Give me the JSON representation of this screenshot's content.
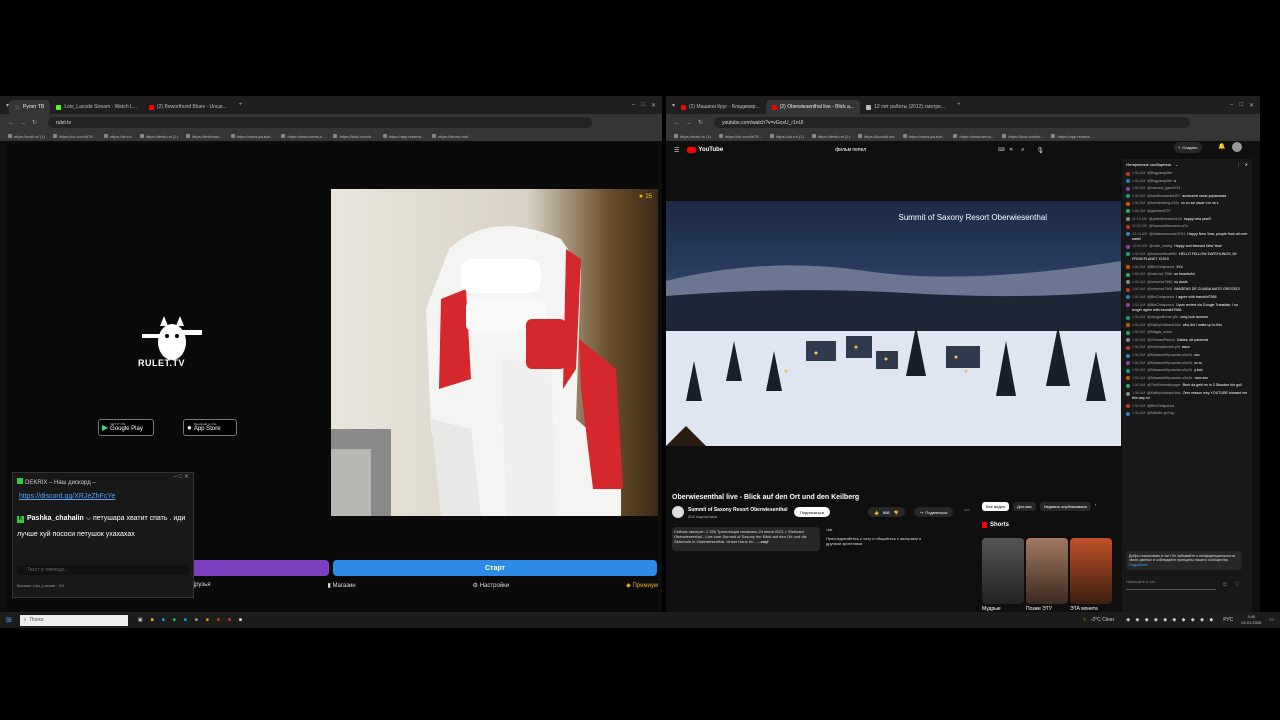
{
  "left_browser": {
    "tabs": [
      "Рулет ТВ",
      "Lois_Lacode Stream - Watch L...",
      "(2) Beworthund Blues - Uncar..."
    ],
    "url": "rulet.tv",
    "bookmarks": [
      "https://mail.ru/ (1)",
      "https://vk.com/id78...",
      "https://ok.ru/",
      "https://tenki.ru/ (1)",
      "https://textbook...",
      "https://www.youtub...",
      "https://www.forms.s...",
      "https://kick.com/lo...",
      "https://app.restrea...",
      "https://dtrmo.md/..."
    ],
    "rulet": {
      "brand": "RULET.TV",
      "google_play": "Google Play",
      "google_play_pre": "GET IT ON",
      "app_store": "App Store",
      "app_store_pre": "Download on the",
      "start_button": "Старт",
      "viewers": "25",
      "bottom_nav": [
        "Друзья",
        "Магазин",
        "Настройки",
        "Премиум"
      ]
    },
    "chat_overlay": {
      "line1": "DEKRIX – Наш дискорд –",
      "link": "https://discord.gg/XRJeZhFcYe",
      "user": "Pashka_chahalin",
      "message": "петушара хватит спать . иди лучше хуй пососи петушок ухахахах",
      "input_placeholder": "Текст в темпедо...",
      "footer_user": "Весная: Lois_Lacode",
      "footer_count": "0/1"
    }
  },
  "right_browser": {
    "tabs": [
      "(2) Машина Круг - Владимир...",
      "(2) Oberwiesenthal live - Blick a...",
      "12 лет работы (2012) смотре..."
    ],
    "url": "youtube.com/watch?v=vGosU_r1nUI",
    "bookmarks": [
      "https://mail.ru/ (1)",
      "https://vk.com/id78...",
      "https://ok.ru/ (1)",
      "https://tenki.ru/ (1)",
      "https://koralid.ua/",
      "https://www.youtub...",
      "https://www.serou...",
      "https://kick.com/lo...",
      "https://app.restrea..."
    ],
    "youtube": {
      "logo": "YouTube",
      "search_query": "фильм пепел",
      "create_label": "Создать",
      "video_overlay_title": "Summit of Saxony Resort Oberwiesenthal",
      "video_title": "Oberwiesenthal live - Blick auf den Ort und den Keilberg",
      "channel": "Summit of Saxony Resort Oberwiesenthal",
      "subscribers": "204 подписчика",
      "subscribe": "Подписаться",
      "likes": "888",
      "share": "Поделиться",
      "description": "Сейчас смотрят: 1 398  Трансляция началась 24 июня 2021 г. Webcam Oberwiesenthal - Live vom Summit of Saxony der Blick auf den Ort und die Skischule in Oberwiesenthal. Unser Haus fin...",
      "more": "...ещё",
      "filters": [
        "Все видео",
        "Для вас",
        "Недавно опубликовано"
      ],
      "shorts_label": "Shorts",
      "shorts_titles": [
        "Мудрые",
        "Позже ЭТУ",
        "ЭТА монета"
      ],
      "chat_panel_title": "Интересные сообщения",
      "chat_mini_title": "Чат",
      "chat_mini_text": "Присоединяйтесь к чату и общайтесь с авторами и другими зрителями.",
      "chat_messages": [
        {
          "time": "1:50 AM",
          "user": "@Bogparapilter",
          "text": ""
        },
        {
          "time": "1:50 AM",
          "user": "@Bogparapilter",
          "text": "s"
        },
        {
          "time": "1:50 AM",
          "user": "@marcinc_gato2074",
          "text": ""
        },
        {
          "time": "1:50 AM",
          "user": "@stanilimstanik4207",
          "text": "включите свою украинкам"
        },
        {
          "time": "1:50 AM",
          "user": "@fuentenberg-n22y",
          "text": "хо хо же хаше что за з."
        },
        {
          "time": "1:56 AM",
          "user": "@gaunter4707",
          "text": ""
        },
        {
          "time": "11:15 AM",
          "user": "@peterlimmlaw4144",
          "text": "happy new year!!"
        },
        {
          "time": "11:32 AM",
          "user": "@KarmedMesmenv-p7u",
          "text": ""
        },
        {
          "time": "12:14 AM",
          "user": "@hidtsnewsensio2041",
          "text": "Happy New Year, people from all over earth!"
        },
        {
          "time": "12:59 AM",
          "user": "@colin_crarkg",
          "text": "Happy and blessed New Year!"
        },
        {
          "time": "1:50 AM",
          "user": "@borenwellcat982",
          "text": "HELLO FELLOW EARTHLINGS, IM FROM PLANET X1919"
        },
        {
          "time": "1:50 AM",
          "user": "@BinChrisponus",
          "text": "ЗУo"
        },
        {
          "time": "1:50 AM",
          "user": "@mirs.hci.7566",
          "text": "so beautiuful"
        },
        {
          "time": "1:50 AM",
          "user": "@mirsehci7566",
          "text": "so dusts"
        },
        {
          "time": "1:50 AM",
          "user": "@mirsehci7566",
          "text": "IMAGENS DE CUIABA MATO GROSSO!"
        },
        {
          "time": "1:50 AM",
          "user": "@BinChrisponus",
          "text": "I agree with tranokhi7566"
        },
        {
          "time": "1:50 AM",
          "user": "@BinChrisponus",
          "text": "Upon review via Google Translate, I no longer agree with tranokhi7566"
        },
        {
          "time": "1:50 AM",
          "user": "@ukrgpoliforce-y9u",
          "text": "omg look lauama"
        },
        {
          "time": "1:50 AM",
          "user": "@KathyHubbard-bbc",
          "text": "why did I wake up to this"
        },
        {
          "time": "1:50 AM",
          "user": "@Miggis_noiim",
          "text": ""
        },
        {
          "time": "1:50 AM",
          "user": "@ZirhalanPalezo",
          "text": "Gabes, de panemai"
        },
        {
          "time": "1:50 AM",
          "user": "@Kalimaatirorek-y9r",
          "text": "вася"
        },
        {
          "time": "1:50 AM",
          "user": "@MiasanielKpuacian-u5u2e",
          "text": "кос"
        },
        {
          "time": "1:50 AM",
          "user": "@MiasanielKpuacian-u5u2e",
          "text": "кс хс"
        },
        {
          "time": "1:50 AM",
          "user": "@MiasanielKpuacian-u5u2e",
          "text": "у вас"
        },
        {
          "time": "1:50 AM",
          "user": "@MiasanielKpuacian-u5u2e",
          "text": "тихо кос"
        },
        {
          "time": "1:50 AM",
          "user": "@TheRobonsbunger",
          "text": "Bruh da geht es in 3 Stunden hin goli"
        },
        {
          "time": "1:50 AM",
          "user": "@KathyHubbard-bbc",
          "text": "Zero reason why YOUTUBE showed me this way lol"
        },
        {
          "time": "1:50 AM",
          "user": "@BinChrisponus",
          "text": ""
        },
        {
          "time": "1:50 AM",
          "user": "@Mix54e-gn7ug",
          "text": ""
        }
      ],
      "welcome_text": "Добро пожаловать в чат! Не забывайте о конфиденциальности своих данных и соблюдайте принципы нашего сообщества.",
      "welcome_link": "Подробнее",
      "chat_input_placeholder": "Напишите в чат"
    }
  },
  "taskbar": {
    "search_placeholder": "Поиск",
    "weather": "-2°C  Clear",
    "lang": "РУС",
    "time": "3:40",
    "date": "02.01.2025"
  },
  "colors": {
    "purple": "#7b3fbf",
    "blue": "#2b8be6",
    "yt_red": "#ff0000",
    "chat_green": "#2ecc40"
  }
}
